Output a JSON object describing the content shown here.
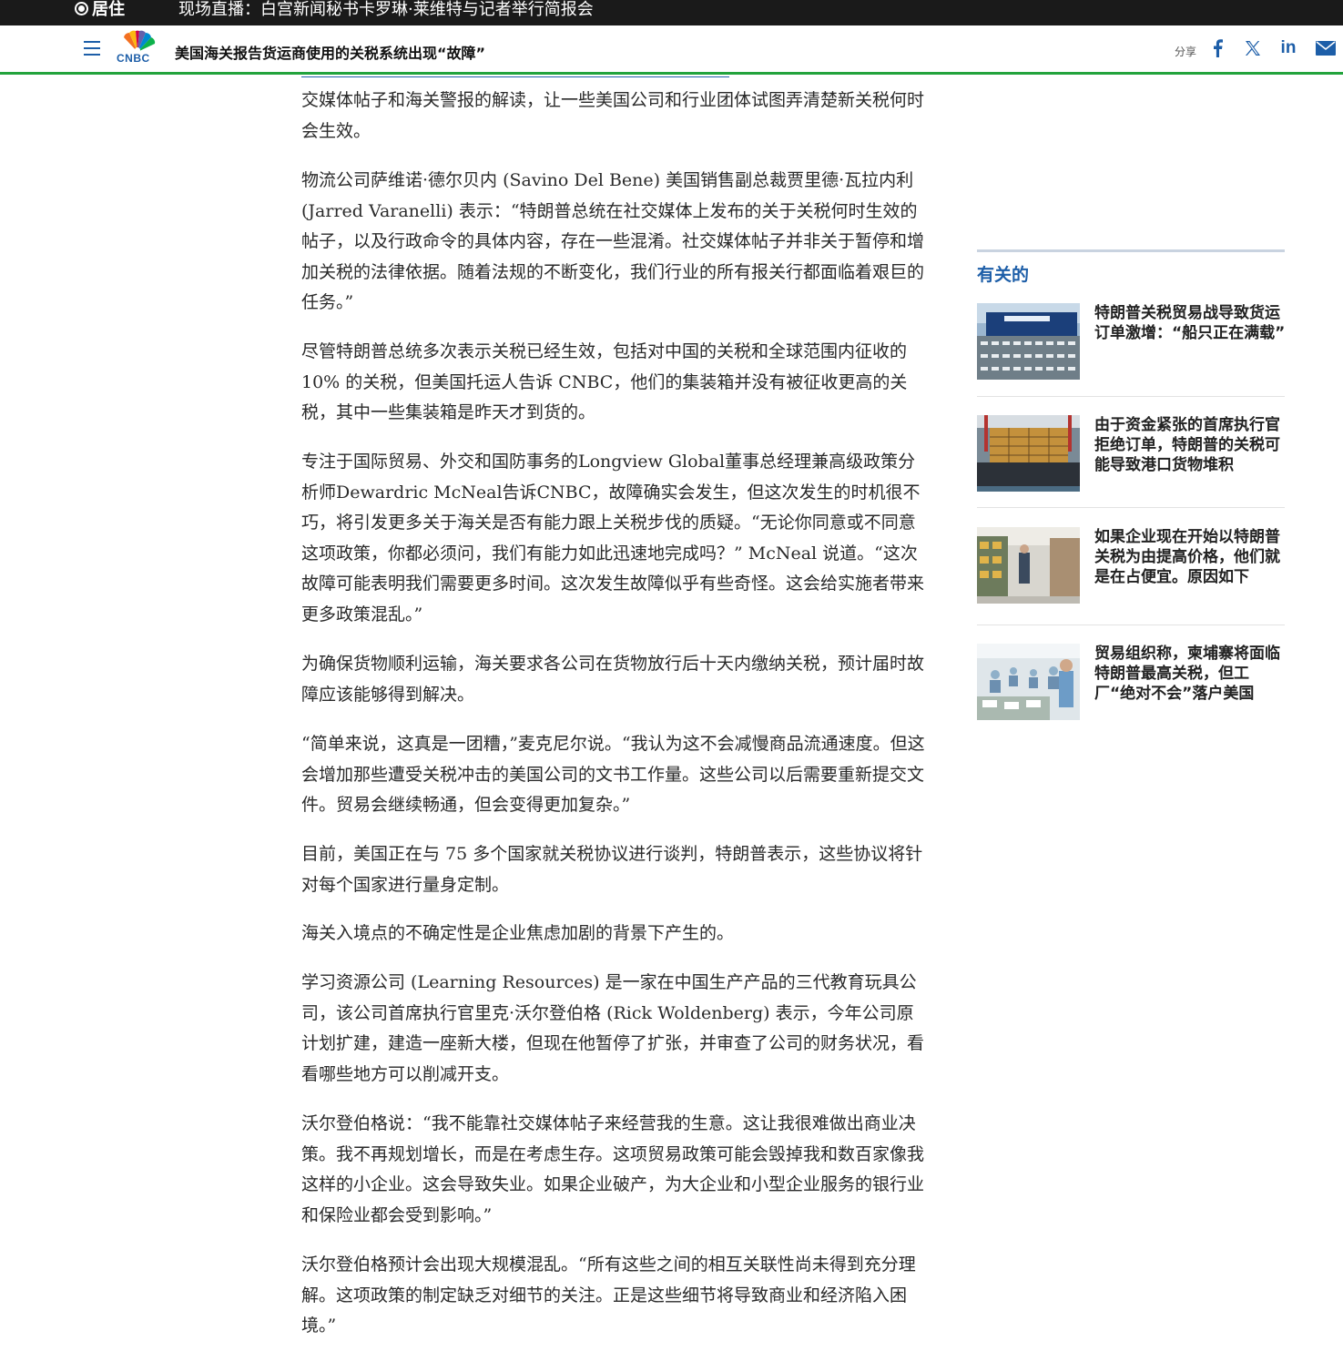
{
  "ticker": {
    "live_label": "居住",
    "headline": "现场直播：白宫新闻秘书卡罗琳·莱维特与记者举行简报会"
  },
  "nav": {
    "logo_text": "CNBC",
    "article_title": "美国海关报告货运商使用的关税系统出现“故障”",
    "share_label": "分享",
    "share_icons": [
      "facebook-icon",
      "x-icon",
      "linkedin-icon",
      "email-icon"
    ],
    "accent_color": "#1d5ea8",
    "rule_color": "#22a33c"
  },
  "article": {
    "paragraphs": [
      "交媒体帖子和海关警报的解读，让一些美国公司和行业团体试图弄清楚新关税何时会生效。",
      "物流公司萨维诺·德尔贝内 (Savino Del Bene) 美国销售副总裁贾里德·瓦拉内利 (Jarred Varanelli) 表示：“特朗普总统在社交媒体上发布的关于关税何时生效的帖子，以及行政命令的具体内容，存在一些混淆。社交媒体帖子并非关于暂停和增加关税的法律依据。随着法规的不断变化，我们行业的所有报关行都面临着艰巨的任务。”",
      "尽管特朗普总统多次表示关税已经生效，包括对中国的关税和全球范围内征收的 10% 的关税，但美国托运人告诉 CNBC，他们的集装箱并没有被征收更高的关税，其中一些集装箱是昨天才到货的。",
      "专注于国际贸易、外交和国防事务的Longview Global董事总经理兼高级政策分析师Dewardric McNeal告诉CNBC，故障确实会发生，但这次发生的时机很不巧，将引发更多关于海关是否有能力跟上关税步伐的质疑。“无论你同意或不同意这项政策，你都必须问，我们有能力如此迅速地完成吗？” McNeal 说道。“这次故障可能表明我们需要更多时间。这次发生故障似乎有些奇怪。这会给实施者带来更多政策混乱。”",
      "为确保货物顺利运输，海关要求各公司在货物放行后十天内缴纳关税，预计届时故障应该能够得到解决。",
      "“简单来说，这真是一团糟，”麦克尼尔说。“我认为这不会减慢商品流通速度。但这会增加那些遭受关税冲击的美国公司的文书工作量。这些公司以后需要重新提交文件。贸易会继续畅通，但会变得更加复杂。”",
      "目前，美国正在与 75 多个国家就关税协议进行谈判，特朗普表示，这些协议将针对每个国家进行量身定制。",
      "海关入境点的不确定性是企业焦虑加剧的背景下产生的。",
      "学习资源公司 (Learning Resources) 是一家在中国生产产品的三代教育玩具公司，该公司首席执行官里克·沃尔登伯格 (Rick Woldenberg) 表示，今年公司原计划扩建，建造一座新大楼，但现在他暂停了扩张，并审查了公司的财务状况，看看哪些地方可以削减开支。",
      "沃尔登伯格说：“我不能靠社交媒体帖子来经营我的生意。这让我很难做出商业决策。我不再规划增长，而是在考虑生存。这项贸易政策可能会毁掉我和数百家像我这样的小企业。这会导致失业。如果企业破产，为大企业和小型企业服务的银行业和保险业都会受到影响。”",
      "沃尔登伯格预计会出现大规模混乱。“所有这些之间的相互关联性尚未得到充分理解。这项政策的制定缺乏对细节的关注。正是这些细节将导致商业和经济陷入困境。”"
    ]
  },
  "sidebar": {
    "related_title": "有关的",
    "items": [
      {
        "title": "特朗普关税贸易战导致货运订单激增：“船只正在满载”",
        "image": "cargo-ship-cars-photo"
      },
      {
        "title": "由于资金紧张的首席执行官拒绝订单，特朗普的关税可能导致港口货物堆积",
        "image": "container-ship-port-photo"
      },
      {
        "title": "如果企业现在开始以特朗普关税为由提高价格，他们就是在占便宜。原因如下",
        "image": "grocery-store-aisle-photo"
      },
      {
        "title": "贸易组织称，柬埔寨将面临特朗普最高关税，但工厂“绝对不会”落户美国",
        "image": "garment-factory-photo"
      }
    ]
  }
}
